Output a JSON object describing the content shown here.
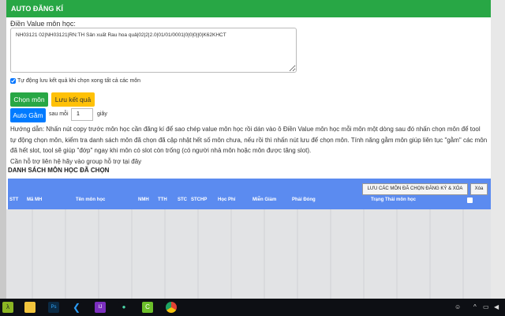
{
  "header": {
    "title": "AUTO ĐĂNG KÍ"
  },
  "form": {
    "label": "Điền Value môn học:",
    "value": "NH03121 02|NH03121|RN:TH Sản xuất Rau hoa quả|02|2|2.0|01/01/0001|0|0|0||0|K62KHCT",
    "auto_save_label": "Tự động lưu kết quả khi chọn xong tất cả các môn",
    "auto_save_checked": true
  },
  "buttons": {
    "choose": "Chọn môn",
    "save": "Lưu kết quả",
    "auto": "Auto Gằm"
  },
  "interval": {
    "prefix": "sau mỗi",
    "value": "1",
    "suffix": "giây"
  },
  "guide": {
    "text": "Hướng dẫn: Nhấn nút copy trước môn học cần đăng kí để sao chép value môn học rồi dán vào ô Điền Value môn học mỗi môn một dòng sau đó nhấn chọn môn để tool tự động chọn môn, kiểm tra danh sách môn đã chọn đã cập nhật hết số môn chưa, nếu rồi thì nhấn nút lưu để chọn môn. Tính năng gằm môn giúp liên tục \"gằm\" các môn đã hết slot, tool sẽ giúp \"đớp\" ngay khi môn có slot còn trống (có người nhả môn hoặc môn được tăng slot).",
    "support": "Cần hỗ trợ liên hệ hãy vào group hỗ trợ tại đây"
  },
  "list": {
    "title": "DANH SÁCH MÔN HỌC ĐÃ CHỌN",
    "save_delete": "LƯU CÁC MÔN ĐÃ CHỌN ĐĂNG KÝ & XÓA",
    "delete": "Xóa",
    "columns": [
      "STT",
      "Mã MH",
      "Tên môn học",
      "NMH",
      "TTH",
      "STC",
      "STCHP",
      "Học Phí",
      "Miễn Giảm",
      "Phải Đóng",
      "Trạng Thái môn học"
    ]
  }
}
